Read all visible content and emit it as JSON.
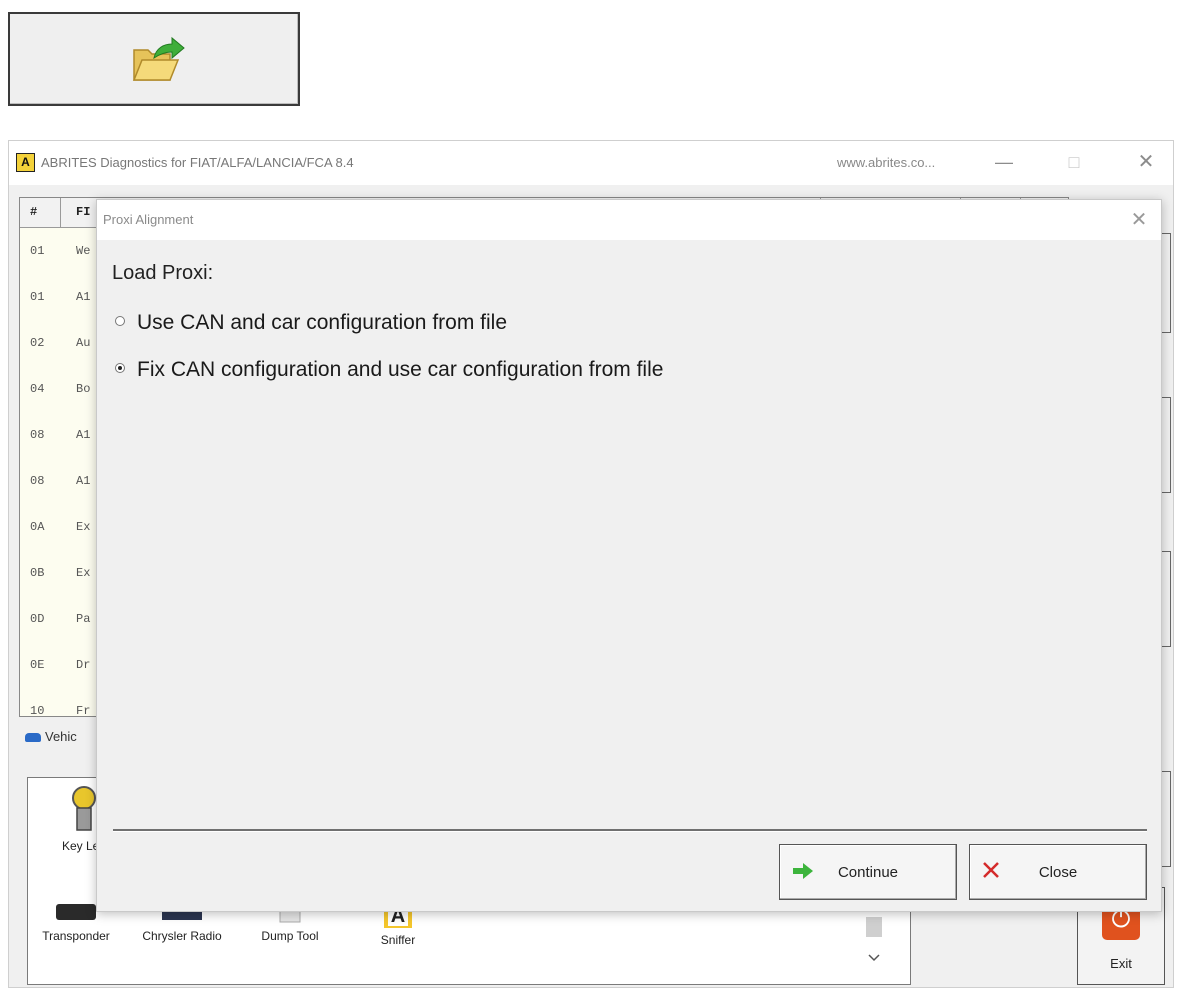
{
  "top_button": {
    "icon": "open-folder-icon"
  },
  "window": {
    "title": "ABRITES Diagnostics for FIAT/ALFA/LANCIA/FCA 8.4",
    "url": "www.abrites.co...",
    "logo": "A",
    "controls": {
      "minimize": "—",
      "maximize": "□",
      "close": "✕"
    }
  },
  "table": {
    "headers": [
      "#",
      "FI"
    ],
    "rows": [
      {
        "id": "01",
        "name": "We"
      },
      {
        "id": "01",
        "name": "A1"
      },
      {
        "id": "02",
        "name": "Au"
      },
      {
        "id": "04",
        "name": "Bo"
      },
      {
        "id": "08",
        "name": "A1"
      },
      {
        "id": "08",
        "name": "A1"
      },
      {
        "id": "0A",
        "name": "Ex"
      },
      {
        "id": "0B",
        "name": "Ex"
      },
      {
        "id": "0D",
        "name": "Pa"
      },
      {
        "id": "0E",
        "name": "Dr"
      },
      {
        "id": "10",
        "name": "Fr"
      }
    ]
  },
  "vehicle_tab": {
    "label": "Vehic"
  },
  "tools": [
    {
      "label": "Key Lea",
      "icon": "key-icon"
    },
    {
      "label": "Transponder",
      "icon": "transponder-icon"
    },
    {
      "label": "Chrysler Radio",
      "icon": "radio-icon"
    },
    {
      "label": "Dump Tool",
      "icon": "dump-tool-icon"
    },
    {
      "label": "Sniffer",
      "icon": "sniffer-icon"
    }
  ],
  "exit": {
    "label": "Exit",
    "icon": "power-icon"
  },
  "dialog": {
    "title": "Proxi Alignment",
    "heading": "Load Proxi:",
    "options": [
      {
        "label": "Use CAN and car configuration from file",
        "selected": false
      },
      {
        "label": "Fix CAN configuration and use car configuration from file",
        "selected": true
      }
    ],
    "buttons": {
      "continue": {
        "label": "Continue",
        "icon": "green-arrow-icon",
        "color": "#3cb43c"
      },
      "close": {
        "label": "Close",
        "icon": "red-x-icon",
        "color": "#d42a2a"
      }
    }
  }
}
